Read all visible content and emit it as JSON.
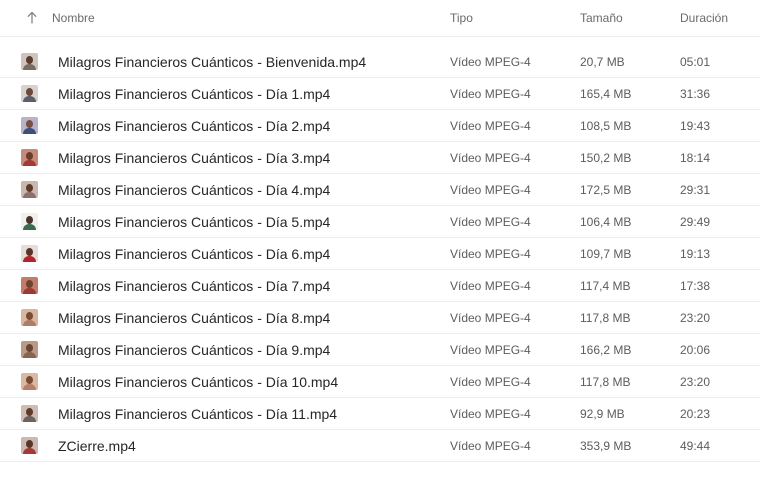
{
  "header": {
    "sort_icon": "arrow-up-icon",
    "name_label": "Nombre",
    "type_label": "Tipo",
    "size_label": "Tamaño",
    "duration_label": "Duración"
  },
  "files": [
    {
      "name": "Milagros Financieros Cuánticos - Bienvenida.mp4",
      "type": "Vídeo MPEG-4",
      "size": "20,7 MB",
      "duration": "05:01",
      "thumb": {
        "bg": "#cfc4bd",
        "head": "#5a3b2e",
        "body": "#7a6a64",
        "icon": "video-thumbnail-icon"
      }
    },
    {
      "name": "Milagros Financieros Cuánticos - Día 1.mp4",
      "type": "Vídeo MPEG-4",
      "size": "165,4 MB",
      "duration": "31:36",
      "thumb": {
        "bg": "#d9d2cc",
        "head": "#6b4a3a",
        "body": "#5b5f6b",
        "icon": "video-thumbnail-icon"
      }
    },
    {
      "name": "Milagros Financieros Cuánticos - Día 2.mp4",
      "type": "Vídeo MPEG-4",
      "size": "108,5 MB",
      "duration": "19:43",
      "thumb": {
        "bg": "#b7b3c8",
        "head": "#7a5140",
        "body": "#3f4f7a",
        "icon": "video-thumbnail-icon"
      }
    },
    {
      "name": "Milagros Financieros Cuánticos - Día 3.mp4",
      "type": "Vídeo MPEG-4",
      "size": "150,2 MB",
      "duration": "18:14",
      "thumb": {
        "bg": "#c88a7a",
        "head": "#6a3e2d",
        "body": "#a23a3a",
        "icon": "video-thumbnail-icon"
      }
    },
    {
      "name": "Milagros Financieros Cuánticos - Día 4.mp4",
      "type": "Vídeo MPEG-4",
      "size": "172,5 MB",
      "duration": "29:31",
      "thumb": {
        "bg": "#c9b8ae",
        "head": "#5b3a2a",
        "body": "#8c6f66",
        "icon": "video-thumbnail-icon"
      }
    },
    {
      "name": "Milagros Financieros Cuánticos - Día 5.mp4",
      "type": "Vídeo MPEG-4",
      "size": "106,4 MB",
      "duration": "29:49",
      "thumb": {
        "bg": "#f2f0ee",
        "head": "#4a3328",
        "body": "#3b6b4f",
        "icon": "video-thumbnail-icon"
      }
    },
    {
      "name": "Milagros Financieros Cuánticos - Día 6.mp4",
      "type": "Vídeo MPEG-4",
      "size": "109,7 MB",
      "duration": "19:13",
      "thumb": {
        "bg": "#e6dcd8",
        "head": "#5a3426",
        "body": "#b2262b",
        "icon": "video-thumbnail-icon"
      }
    },
    {
      "name": "Milagros Financieros Cuánticos - Día 7.mp4",
      "type": "Vídeo MPEG-4",
      "size": "117,4 MB",
      "duration": "17:38",
      "thumb": {
        "bg": "#c47c6a",
        "head": "#6e4332",
        "body": "#9a3a34",
        "icon": "video-thumbnail-icon"
      }
    },
    {
      "name": "Milagros Financieros Cuánticos - Día 8.mp4",
      "type": "Vídeo MPEG-4",
      "size": "117,8 MB",
      "duration": "23:20",
      "thumb": {
        "bg": "#d7b7a2",
        "head": "#7b4a33",
        "body": "#b07c62",
        "icon": "video-thumbnail-icon"
      }
    },
    {
      "name": "Milagros Financieros Cuánticos - Día 9.mp4",
      "type": "Vídeo MPEG-4",
      "size": "166,2 MB",
      "duration": "20:06",
      "thumb": {
        "bg": "#b89a86",
        "head": "#6b4330",
        "body": "#8a6350",
        "icon": "video-thumbnail-icon"
      }
    },
    {
      "name": "Milagros Financieros Cuánticos - Día 10.mp4",
      "type": "Vídeo MPEG-4",
      "size": "117,8 MB",
      "duration": "23:20",
      "thumb": {
        "bg": "#d9b9a4",
        "head": "#7a4a34",
        "body": "#b57f66",
        "icon": "video-thumbnail-icon"
      }
    },
    {
      "name": "Milagros Financieros Cuánticos - Día 11.mp4",
      "type": "Vídeo MPEG-4",
      "size": "92,9 MB",
      "duration": "20:23",
      "thumb": {
        "bg": "#cdbdb2",
        "head": "#5e3c2c",
        "body": "#6e6260",
        "icon": "video-thumbnail-icon"
      }
    },
    {
      "name": "ZCierre.mp4",
      "type": "Vídeo MPEG-4",
      "size": "353,9 MB",
      "duration": "49:44",
      "thumb": {
        "bg": "#cdb8b0",
        "head": "#5a3628",
        "body": "#a33a3a",
        "icon": "video-thumbnail-icon"
      }
    }
  ]
}
